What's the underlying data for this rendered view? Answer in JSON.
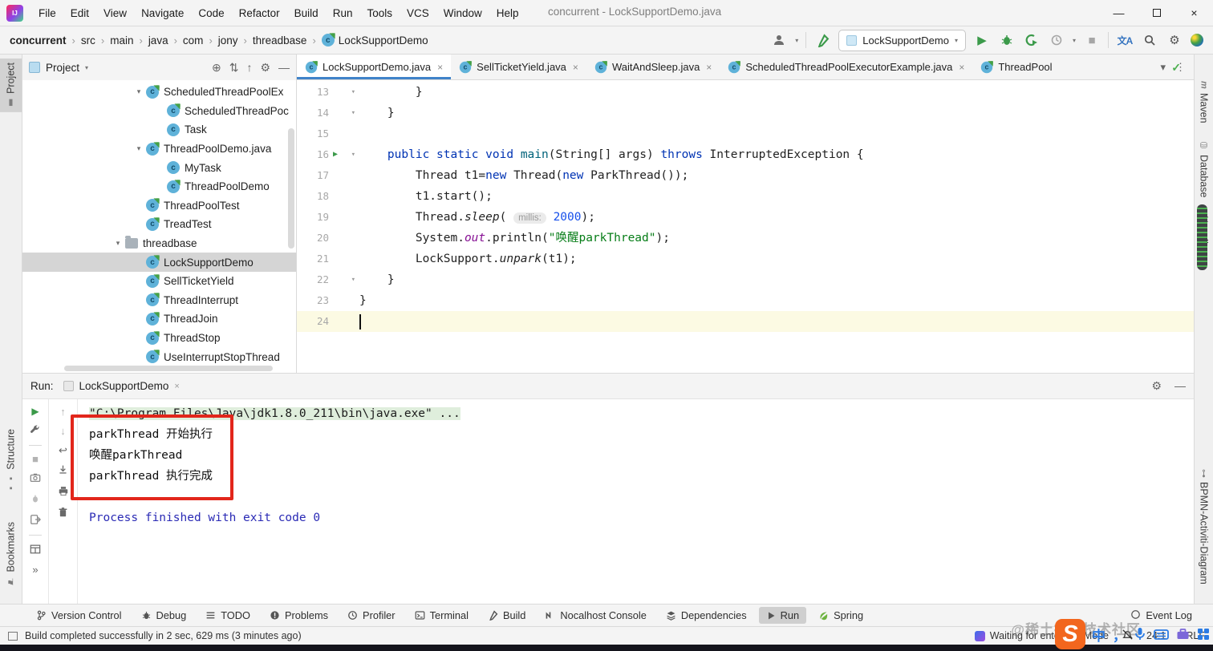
{
  "icons": {
    "minimize": "—",
    "close": "×",
    "dropdown": "▾",
    "breadcrumb_sep": "›",
    "more_v": "⋮",
    "tabs_chevron": "▾",
    "locate": "⊕",
    "gear": "⚙",
    "hide": "—",
    "play": "▶",
    "stop": "■",
    "up": "↑",
    "down": "↓",
    "soft_wrap": "↩",
    "more": "»",
    "check": "✓",
    "close_tab": "×",
    "translate": "文A",
    "expand_all": "⇅",
    "collapse_all": "↑",
    "tree_expanded": "▾",
    "fold": "▾",
    "class_letter": "c",
    "logo": "IJ",
    "event_log_dot": "○"
  },
  "titlebar": {
    "menu": [
      "File",
      "Edit",
      "View",
      "Navigate",
      "Code",
      "Refactor",
      "Build",
      "Run",
      "Tools",
      "VCS",
      "Window",
      "Help"
    ],
    "window_title": "concurrent - LockSupportDemo.java"
  },
  "breadcrumbs": {
    "items": [
      "concurrent",
      "src",
      "main",
      "java",
      "com",
      "jony",
      "threadbase"
    ],
    "class_name": "LockSupportDemo"
  },
  "toolbar": {
    "run_config": "LockSupportDemo"
  },
  "left_stripe": {
    "project": "Project",
    "structure": "Structure",
    "bookmarks": "Bookmarks"
  },
  "right_stripe": {
    "maven": "Maven",
    "maven_icon": "m",
    "database": "Database",
    "nocalhost": "Nocalhost",
    "bpmn": "BPMN-Activiti-Diagram"
  },
  "project_panel": {
    "title": "Project",
    "tree": [
      {
        "label": "ScheduledThreadPoolEx",
        "type": "class-run",
        "indent": 3,
        "chevron": true
      },
      {
        "label": "ScheduledThreadPoc",
        "type": "class-run",
        "indent": 4
      },
      {
        "label": "Task",
        "type": "class",
        "indent": 4
      },
      {
        "label": "ThreadPoolDemo.java",
        "type": "class-run",
        "indent": 3,
        "chevron": true
      },
      {
        "label": "MyTask",
        "type": "class",
        "indent": 4
      },
      {
        "label": "ThreadPoolDemo",
        "type": "class-run",
        "indent": 4
      },
      {
        "label": "ThreadPoolTest",
        "type": "class-run",
        "indent": 3
      },
      {
        "label": "TreadTest",
        "type": "class-run",
        "indent": 3
      },
      {
        "label": "threadbase",
        "type": "folder",
        "indent": 2,
        "chevron": true
      },
      {
        "label": "LockSupportDemo",
        "type": "class-run",
        "indent": 3,
        "selected": true
      },
      {
        "label": "SellTicketYield",
        "type": "class-run",
        "indent": 3
      },
      {
        "label": "ThreadInterrupt",
        "type": "class-run",
        "indent": 3
      },
      {
        "label": "ThreadJoin",
        "type": "class-run",
        "indent": 3
      },
      {
        "label": "ThreadStop",
        "type": "class-run",
        "indent": 3
      },
      {
        "label": "UseInterruptStopThread",
        "type": "class-run",
        "indent": 3
      }
    ]
  },
  "editor": {
    "tabs": [
      {
        "label": "LockSupportDemo.java",
        "active": true
      },
      {
        "label": "SellTicketYield.java"
      },
      {
        "label": "WaitAndSleep.java"
      },
      {
        "label": "ScheduledThreadPoolExecutorExample.java"
      },
      {
        "label": "ThreadPool",
        "closable": false
      }
    ],
    "code": [
      {
        "n": 13,
        "fold": true,
        "tokens": [
          [
            "p",
            "        }"
          ]
        ]
      },
      {
        "n": 14,
        "fold": true,
        "tokens": [
          [
            "p",
            "    }"
          ]
        ]
      },
      {
        "n": 15,
        "tokens": []
      },
      {
        "n": 16,
        "fold": true,
        "run": true,
        "tokens": [
          [
            "p",
            "    "
          ],
          [
            "k",
            "public"
          ],
          [
            "p",
            " "
          ],
          [
            "k",
            "static"
          ],
          [
            "p",
            " "
          ],
          [
            "k",
            "void"
          ],
          [
            "p",
            " "
          ],
          [
            "m",
            "main"
          ],
          [
            "p",
            "(String[] args) "
          ],
          [
            "k",
            "throws"
          ],
          [
            "p",
            " InterruptedException {"
          ]
        ]
      },
      {
        "n": 17,
        "tokens": [
          [
            "p",
            "        Thread t1="
          ],
          [
            "k",
            "new"
          ],
          [
            "p",
            " Thread("
          ],
          [
            "k",
            "new"
          ],
          [
            "p",
            " ParkThread());"
          ]
        ]
      },
      {
        "n": 18,
        "tokens": [
          [
            "p",
            "        t1.start();"
          ]
        ]
      },
      {
        "n": 19,
        "tokens": [
          [
            "p",
            "        Thread."
          ],
          [
            "i",
            "sleep"
          ],
          [
            "p",
            "( "
          ],
          [
            "h",
            "millis:"
          ],
          [
            "p",
            " "
          ],
          [
            "n",
            "2000"
          ],
          [
            "p",
            ");"
          ]
        ]
      },
      {
        "n": 20,
        "tokens": [
          [
            "p",
            "        System."
          ],
          [
            "f",
            "out"
          ],
          [
            "p",
            ".println("
          ],
          [
            "s",
            "\"唤醒parkThread\""
          ],
          [
            "p",
            ");"
          ]
        ]
      },
      {
        "n": 21,
        "tokens": [
          [
            "p",
            "        LockSupport."
          ],
          [
            "i",
            "unpark"
          ],
          [
            "p",
            "(t1);"
          ]
        ]
      },
      {
        "n": 22,
        "fold": true,
        "tokens": [
          [
            "p",
            "    }"
          ]
        ]
      },
      {
        "n": 23,
        "tokens": [
          [
            "p",
            "}"
          ]
        ]
      },
      {
        "n": 24,
        "caret": true,
        "tokens": []
      }
    ]
  },
  "run_panel": {
    "label": "Run:",
    "tab": "LockSupportDemo",
    "console": [
      {
        "t": "cmd",
        "text": "\"C:\\Program Files\\Java\\jdk1.8.0_211\\bin\\java.exe\" ..."
      },
      {
        "t": "out",
        "text": "parkThread 开始执行"
      },
      {
        "t": "out",
        "text": "唤醒parkThread"
      },
      {
        "t": "out",
        "text": "parkThread 执行完成"
      },
      {
        "t": "blank",
        "text": ""
      },
      {
        "t": "sys",
        "text": "Process finished with exit code 0"
      }
    ]
  },
  "bottom_bar": {
    "items": [
      {
        "icon": "branch",
        "label": "Version Control"
      },
      {
        "icon": "bug",
        "label": "Debug"
      },
      {
        "icon": "list",
        "label": "TODO"
      },
      {
        "icon": "error",
        "label": "Problems"
      },
      {
        "icon": "profiler",
        "label": "Profiler"
      },
      {
        "icon": "terminal",
        "label": "Terminal"
      },
      {
        "icon": "hammer",
        "label": "Build"
      },
      {
        "icon": "nocalhost",
        "label": "Nocalhost Console"
      },
      {
        "icon": "layers",
        "label": "Dependencies"
      },
      {
        "icon": "play",
        "label": "Run",
        "active": true
      },
      {
        "icon": "leaf",
        "label": "Spring"
      }
    ],
    "event_log": "Event Log"
  },
  "status_bar": {
    "message": "Build completed successfully in 2 sec, 629 ms (3 minutes ago)",
    "devmode": "Waiting for enter DevMode",
    "caret_position": "24:1",
    "line_ending": "CRLF"
  },
  "watermark": {
    "logo_letter": "S",
    "handle": "@稀土掘金技术社区",
    "ime_cn": "中",
    "ime_punct": "，"
  },
  "colors": {
    "accent_blue": "#4083C9",
    "keyword": "#0033B3",
    "string": "#067D17",
    "number": "#1750EB",
    "field": "#871094",
    "method": "#00627A",
    "run_green": "#3B9A4A",
    "annotation_red": "#E2261B",
    "console_system": "#2A2AB5",
    "caret_row": "#FCFAE3",
    "selection_gray": "#D5D5D5"
  }
}
